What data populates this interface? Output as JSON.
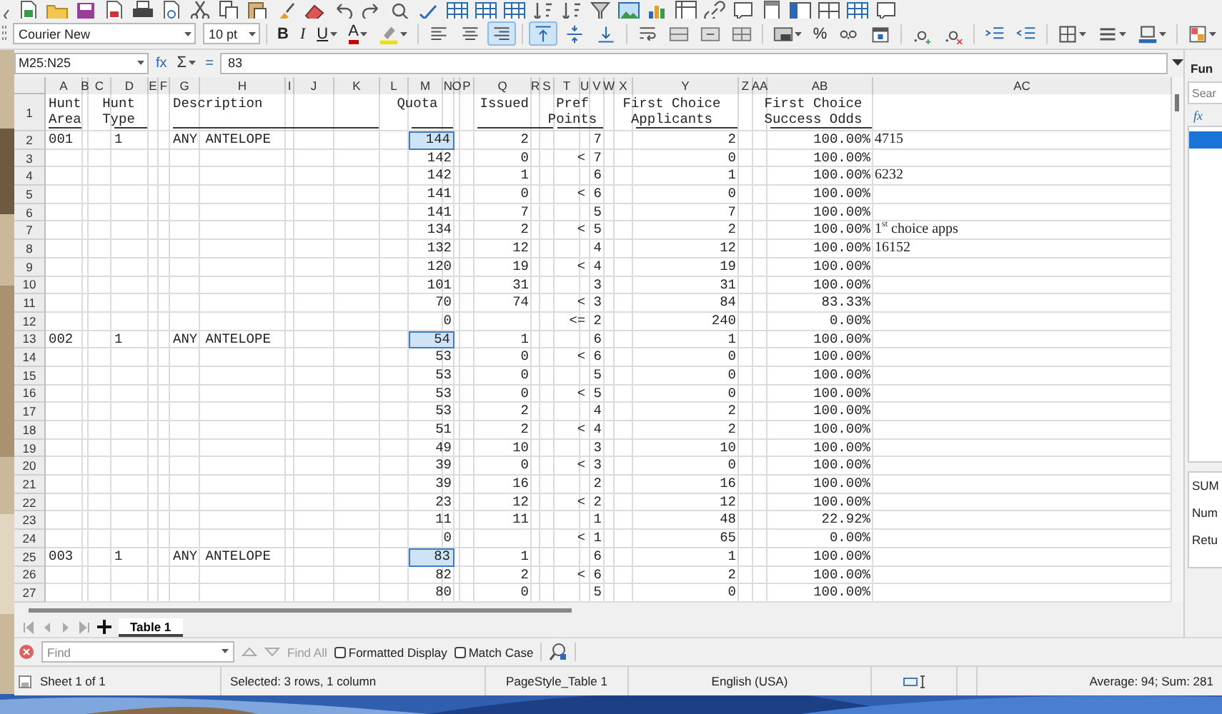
{
  "format_bar": {
    "font_name": "Courier New",
    "font_size": "10 pt",
    "buttons": [
      {
        "kind": "bold",
        "label": "B",
        "active": false
      },
      {
        "kind": "italic",
        "label": "I",
        "active": false
      },
      {
        "kind": "underline",
        "label": "U",
        "active": false
      },
      {
        "kind": "font-color",
        "label": "A",
        "active": false
      },
      {
        "kind": "highlight",
        "active": false
      },
      {
        "kind": "align-left",
        "active": false
      },
      {
        "kind": "align-center",
        "active": false
      },
      {
        "kind": "align-right",
        "active": true
      },
      {
        "kind": "align-top",
        "active": true
      },
      {
        "kind": "align-middle",
        "active": false
      },
      {
        "kind": "align-bottom",
        "active": false
      },
      {
        "kind": "wrap",
        "active": false
      },
      {
        "kind": "merge",
        "active": false
      },
      {
        "kind": "merge-center",
        "active": false
      },
      {
        "kind": "unmerge",
        "active": false
      },
      {
        "kind": "number-format",
        "active": false
      },
      {
        "kind": "percent",
        "label": "%",
        "active": false
      },
      {
        "kind": "decimal",
        "active": false
      },
      {
        "kind": "date",
        "active": false
      },
      {
        "kind": "add-decimal",
        "active": false
      },
      {
        "kind": "delete-decimal",
        "active": false
      },
      {
        "kind": "indent",
        "active": false
      },
      {
        "kind": "outdent",
        "active": false
      },
      {
        "kind": "borders",
        "active": false
      },
      {
        "kind": "border-style",
        "active": false
      },
      {
        "kind": "border-color",
        "active": false
      },
      {
        "kind": "conditional",
        "active": false
      }
    ]
  },
  "formula_bar": {
    "name_box": "M25:N25",
    "buttons": [
      "fx",
      "Σ",
      "="
    ],
    "content": "83"
  },
  "columns": [
    "A",
    "B",
    "C",
    "D",
    "E",
    "F",
    "G",
    "H",
    "I",
    "J",
    "K",
    "L",
    "M",
    "N",
    "O",
    "P",
    "Q",
    "R",
    "S",
    "T",
    "U",
    "V",
    "W",
    "X",
    "Y",
    "Z",
    "AA",
    "AB",
    "AC"
  ],
  "header": {
    "row": "1",
    "hunt_area": "Hunt\nArea",
    "hunt_type": "Hunt\nType",
    "description": "Description",
    "quota": "Quota",
    "issued": "Issued",
    "pref_points": "Pref\nPoints",
    "applicants": "First Choice\nApplicants",
    "success_odds": "First Choice\nSuccess Odds"
  },
  "rows": [
    {
      "row": "2",
      "hunt_area": "001",
      "hunt_type": "1",
      "description": "ANY ANTELOPE",
      "quota": "144",
      "quota_selected": true,
      "issued": "2",
      "pref_points": "7",
      "applicants": "2",
      "success_odds": "100.00%",
      "note": "4715"
    },
    {
      "row": "3",
      "quota": "142",
      "quota_selected": false,
      "issued": "0",
      "pref_points": "< 7",
      "applicants": "0",
      "success_odds": "100.00%"
    },
    {
      "row": "4",
      "quota": "142",
      "quota_selected": false,
      "issued": "1",
      "pref_points": "6",
      "applicants": "1",
      "success_odds": "100.00%",
      "note": "6232"
    },
    {
      "row": "5",
      "quota": "141",
      "quota_selected": false,
      "issued": "0",
      "pref_points": "< 6",
      "applicants": "0",
      "success_odds": "100.00%"
    },
    {
      "row": "6",
      "quota": "141",
      "quota_selected": false,
      "issued": "7",
      "pref_points": "5",
      "applicants": "7",
      "success_odds": "100.00%"
    },
    {
      "row": "7",
      "quota": "134",
      "quota_selected": false,
      "issued": "2",
      "pref_points": "< 5",
      "applicants": "2",
      "success_odds": "100.00%",
      "note": "1$^{st}$ choice apps"
    },
    {
      "row": "8",
      "quota": "132",
      "quota_selected": false,
      "issued": "12",
      "pref_points": "4",
      "applicants": "12",
      "success_odds": "100.00%",
      "note": "16152"
    },
    {
      "row": "9",
      "quota": "120",
      "quota_selected": false,
      "issued": "19",
      "pref_points": "< 4",
      "applicants": "19",
      "success_odds": "100.00%"
    },
    {
      "row": "10",
      "quota": "101",
      "quota_selected": false,
      "issued": "31",
      "pref_points": "3",
      "applicants": "31",
      "success_odds": "100.00%"
    },
    {
      "row": "11",
      "quota": "70",
      "quota_selected": false,
      "issued": "74",
      "pref_points": "< 3",
      "applicants": "84",
      "success_odds": "83.33%"
    },
    {
      "row": "12",
      "quota": "0",
      "quota_selected": false,
      "pref_points": "<= 2",
      "applicants": "240",
      "success_odds": "0.00%"
    },
    {
      "row": "13",
      "hunt_area": "002",
      "hunt_type": "1",
      "description": "ANY ANTELOPE",
      "quota": "54",
      "quota_selected": true,
      "issued": "1",
      "pref_points": "6",
      "applicants": "1",
      "success_odds": "100.00%"
    },
    {
      "row": "14",
      "quota": "53",
      "quota_selected": false,
      "issued": "0",
      "pref_points": "< 6",
      "applicants": "0",
      "success_odds": "100.00%"
    },
    {
      "row": "15",
      "quota": "53",
      "quota_selected": false,
      "issued": "0",
      "pref_points": "5",
      "applicants": "0",
      "success_odds": "100.00%"
    },
    {
      "row": "16",
      "quota": "53",
      "quota_selected": false,
      "issued": "0",
      "pref_points": "< 5",
      "applicants": "0",
      "success_odds": "100.00%"
    },
    {
      "row": "17",
      "quota": "53",
      "quota_selected": false,
      "issued": "2",
      "pref_points": "4",
      "applicants": "2",
      "success_odds": "100.00%"
    },
    {
      "row": "18",
      "quota": "51",
      "quota_selected": false,
      "issued": "2",
      "pref_points": "< 4",
      "applicants": "2",
      "success_odds": "100.00%"
    },
    {
      "row": "19",
      "quota": "49",
      "quota_selected": false,
      "issued": "10",
      "pref_points": "3",
      "applicants": "10",
      "success_odds": "100.00%"
    },
    {
      "row": "20",
      "quota": "39",
      "quota_selected": false,
      "issued": "0",
      "pref_points": "< 3",
      "applicants": "0",
      "success_odds": "100.00%"
    },
    {
      "row": "21",
      "quota": "39",
      "quota_selected": false,
      "issued": "16",
      "pref_points": "2",
      "applicants": "16",
      "success_odds": "100.00%"
    },
    {
      "row": "22",
      "quota": "23",
      "quota_selected": false,
      "issued": "12",
      "pref_points": "< 2",
      "applicants": "12",
      "success_odds": "100.00%"
    },
    {
      "row": "23",
      "quota": "11",
      "quota_selected": false,
      "issued": "11",
      "pref_points": "1",
      "applicants": "48",
      "success_odds": "22.92%"
    },
    {
      "row": "24",
      "quota": "0",
      "quota_selected": false,
      "pref_points": "< 1",
      "applicants": "65",
      "success_odds": "0.00%"
    },
    {
      "row": "25",
      "hunt_area": "003",
      "hunt_type": "1",
      "description": "ANY ANTELOPE",
      "quota": "83",
      "quota_selected": true,
      "issued": "1",
      "pref_points": "6",
      "applicants": "1",
      "success_odds": "100.00%"
    },
    {
      "row": "26",
      "quota": "82",
      "quota_selected": false,
      "issued": "2",
      "pref_points": "< 6",
      "applicants": "2",
      "success_odds": "100.00%"
    },
    {
      "row": "27",
      "quota": "80",
      "quota_selected": false,
      "issued": "0",
      "pref_points": "5",
      "applicants": "0",
      "success_odds": "100.00%"
    }
  ],
  "sidebar": {
    "title": "Fun",
    "search_placeholder": "Sear",
    "insert_label": "fx",
    "functions": [
      {
        "selected": true
      }
    ],
    "details": [
      "SUM",
      "Num",
      "Retu"
    ]
  },
  "sheet_tabs": [
    {
      "label": "Table 1",
      "selected": true
    }
  ],
  "find_bar": {
    "placeholder": "Find",
    "find_all": "Find All",
    "find_all_disabled": true,
    "options": [
      {
        "label": "Formatted Display",
        "checked": false
      },
      {
        "label": "Match Case",
        "checked": false
      }
    ]
  },
  "status_bar": {
    "sheet": "Sheet 1 of 1",
    "selection": "Selected: 3 rows, 1 column",
    "page_style": "PageStyle_Table 1",
    "language": "English (USA)",
    "summary": "Average: 94; Sum: 281"
  }
}
